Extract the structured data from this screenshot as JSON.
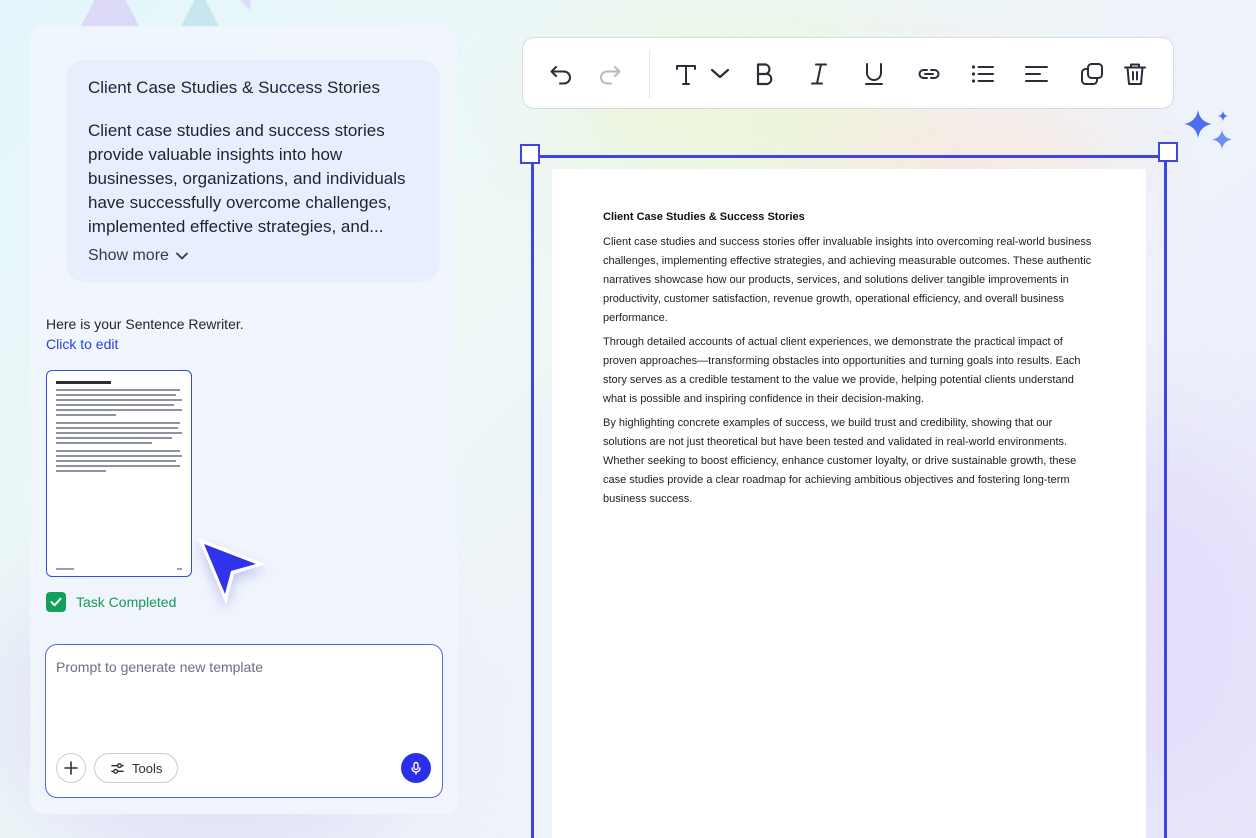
{
  "chat": {
    "ai_card": {
      "title": "Client Case Studies & Success Stories",
      "body": "Client case studies and success stories provide valuable insights into how businesses, organizations, and individuals have successfully overcome challenges, implemented effective strategies, and...",
      "show_more": "Show more"
    },
    "rewriter_message": "Here is your Sentence Rewriter.",
    "click_to_edit": "Click to edit",
    "task_status": "Task Completed",
    "prompt": {
      "placeholder": "Prompt to generate new template",
      "tools_label": "Tools"
    }
  },
  "toolbar": {
    "buttons": [
      "undo-icon",
      "redo-icon",
      "text-style-icon",
      "chevron-down-icon",
      "bold-icon",
      "italic-icon",
      "underline-icon",
      "link-icon",
      "bullet-list-icon",
      "align-left-icon",
      "duplicate-icon",
      "delete-icon"
    ]
  },
  "document": {
    "title": "Client Case Studies & Success Stories",
    "paragraphs": [
      "Client case studies and success stories offer invaluable insights into overcoming real-world business challenges, implementing effective strategies, and achieving measurable outcomes. These authentic narratives showcase how our products, services, and solutions deliver tangible improvements in productivity, customer satisfaction, revenue growth, operational efficiency, and overall business performance.",
      "Through detailed accounts of actual client experiences, we demonstrate the practical impact of proven approaches—transforming obstacles into opportunities and turning goals into results. Each story serves as a credible testament to the value we provide, helping potential clients understand what is possible and inspiring confidence in their decision-making.",
      "By highlighting concrete examples of success, we build trust and credibility, showing that our solutions are not just theoretical but have been tested and validated in real-world environments. Whether seeking to boost efficiency, enhance customer loyalty, or drive sustainable growth, these case studies provide a clear roadmap for achieving ambitious objectives and fostering long-term business success."
    ]
  },
  "colors": {
    "accent": "#3f45df",
    "success": "#12a05a",
    "link": "#2a3fe0"
  }
}
